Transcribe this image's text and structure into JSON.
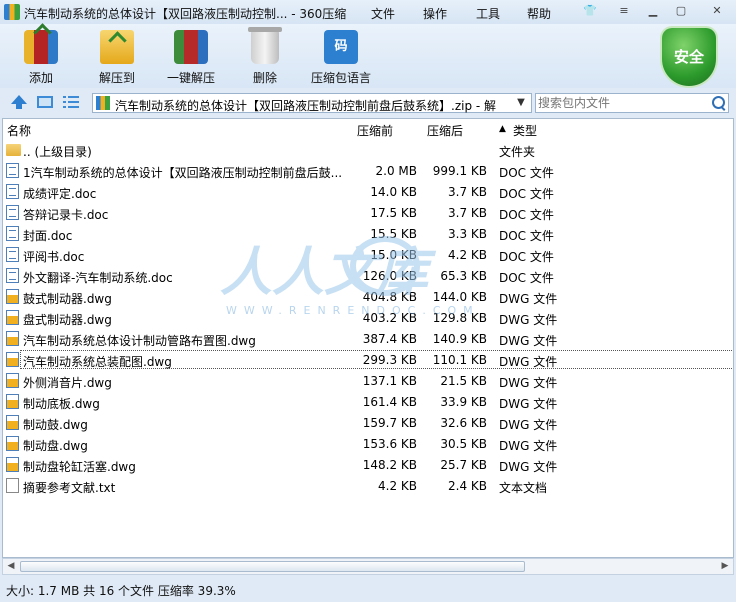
{
  "window": {
    "title": "汽车制动系统的总体设计【双回路液压制动控制... - 360压缩",
    "controls": [
      "shirt-icon",
      "minimize",
      "maximize",
      "close"
    ]
  },
  "menu": [
    {
      "label": "文件"
    },
    {
      "label": "操作"
    },
    {
      "label": "工具"
    },
    {
      "label": "帮助"
    }
  ],
  "toolbar": {
    "buttons": [
      {
        "label": "添加",
        "icon": "add-archive-icon"
      },
      {
        "label": "解压到",
        "icon": "extract-icon"
      },
      {
        "label": "一键解压",
        "icon": "one-click-extract-icon"
      },
      {
        "label": "删除",
        "icon": "trash-icon"
      },
      {
        "label": "压缩包语言",
        "icon": "archive-language-icon",
        "icon_text": "码"
      }
    ],
    "security_badge": {
      "label": "安全",
      "color": "#2c9a2c"
    }
  },
  "address_bar": {
    "path": "汽车制动系统的总体设计【双回路液压制动控制前盘后鼓系统】.zip - 解",
    "search_placeholder": "搜索包内文件"
  },
  "columns": {
    "name": "名称",
    "size": "压缩前",
    "compressed": "压缩后",
    "type": "类型",
    "sort_indicator": "▲"
  },
  "files": [
    {
      "name": ".. (上级目录)",
      "size": "",
      "compressed": "",
      "type": "文件夹",
      "icon": "folder-icon"
    },
    {
      "name": "1汽车制动系统的总体设计【双回路液压制动控制前盘后鼓...",
      "size": "2.0 MB",
      "compressed": "999.1 KB",
      "type": "DOC 文件",
      "icon": "doc-icon"
    },
    {
      "name": "成绩评定.doc",
      "size": "14.0 KB",
      "compressed": "3.7 KB",
      "type": "DOC 文件",
      "icon": "doc-icon"
    },
    {
      "name": "答辩记录卡.doc",
      "size": "17.5 KB",
      "compressed": "3.7 KB",
      "type": "DOC 文件",
      "icon": "doc-icon"
    },
    {
      "name": "封面.doc",
      "size": "15.5 KB",
      "compressed": "3.3 KB",
      "type": "DOC 文件",
      "icon": "doc-icon"
    },
    {
      "name": "评阅书.doc",
      "size": "15.0 KB",
      "compressed": "4.2 KB",
      "type": "DOC 文件",
      "icon": "doc-icon"
    },
    {
      "name": "外文翻译-汽车制动系统.doc",
      "size": "126.0 KB",
      "compressed": "65.3 KB",
      "type": "DOC 文件",
      "icon": "doc-icon"
    },
    {
      "name": "鼓式制动器.dwg",
      "size": "404.8 KB",
      "compressed": "144.0 KB",
      "type": "DWG 文件",
      "icon": "dwg-icon"
    },
    {
      "name": "盘式制动器.dwg",
      "size": "403.2 KB",
      "compressed": "129.8 KB",
      "type": "DWG 文件",
      "icon": "dwg-icon"
    },
    {
      "name": "汽车制动系统总体设计制动管路布置图.dwg",
      "size": "387.4 KB",
      "compressed": "140.9 KB",
      "type": "DWG 文件",
      "icon": "dwg-icon"
    },
    {
      "name": "汽车制动系统总装配图.dwg",
      "size": "299.3 KB",
      "compressed": "110.1 KB",
      "type": "DWG 文件",
      "icon": "dwg-icon",
      "selected": true
    },
    {
      "name": "外侧消音片.dwg",
      "size": "137.1 KB",
      "compressed": "21.5 KB",
      "type": "DWG 文件",
      "icon": "dwg-icon"
    },
    {
      "name": "制动底板.dwg",
      "size": "161.4 KB",
      "compressed": "33.9 KB",
      "type": "DWG 文件",
      "icon": "dwg-icon"
    },
    {
      "name": "制动鼓.dwg",
      "size": "159.7 KB",
      "compressed": "32.6 KB",
      "type": "DWG 文件",
      "icon": "dwg-icon"
    },
    {
      "name": "制动盘.dwg",
      "size": "153.6 KB",
      "compressed": "30.5 KB",
      "type": "DWG 文件",
      "icon": "dwg-icon"
    },
    {
      "name": "制动盘轮缸活塞.dwg",
      "size": "148.2 KB",
      "compressed": "25.7 KB",
      "type": "DWG 文件",
      "icon": "dwg-icon"
    },
    {
      "name": "摘要参考文献.txt",
      "size": "4.2 KB",
      "compressed": "2.4 KB",
      "type": "文本文档",
      "icon": "txt-icon"
    }
  ],
  "status": {
    "text": "大小: 1.7 MB 共 16 个文件 压缩率 39.3%"
  },
  "watermark": {
    "text": "人人文库",
    "subtext": "WWW.RENRENDOC.COM"
  }
}
